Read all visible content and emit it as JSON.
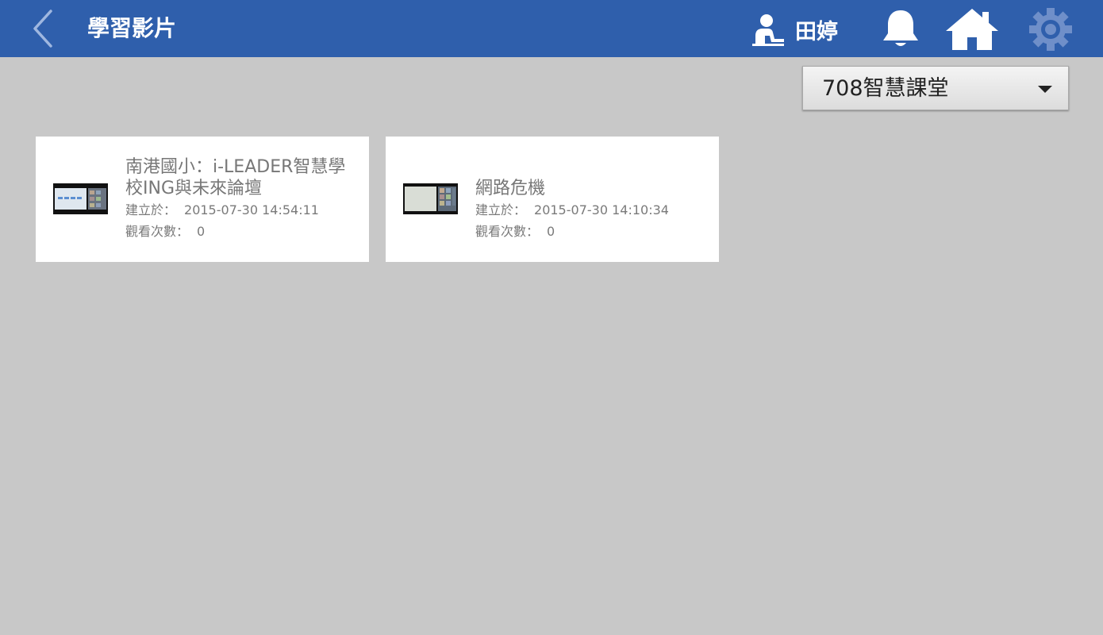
{
  "header": {
    "title": "學習影片",
    "user_name": "田婷",
    "colors": {
      "bar": "#2f5fac",
      "text": "#ffffff",
      "icons": "#ffffff",
      "settings_icon": "#6f8fc9"
    },
    "icons": [
      "back-chevron-icon",
      "user-icon",
      "bell-icon",
      "home-icon",
      "gear-icon"
    ]
  },
  "classroom_select": {
    "selected": "708智慧課堂"
  },
  "videos": [
    {
      "title": "南港國小：i-LEADER智慧學校ING與未來論壇",
      "created_label": "建立於：",
      "created_at": "2015-07-30 14:54:11",
      "views_label": "觀看次數：",
      "views": "0"
    },
    {
      "title": "網路危機",
      "created_label": "建立於：",
      "created_at": "2015-07-30 14:10:34",
      "views_label": "觀看次數：",
      "views": "0"
    }
  ]
}
